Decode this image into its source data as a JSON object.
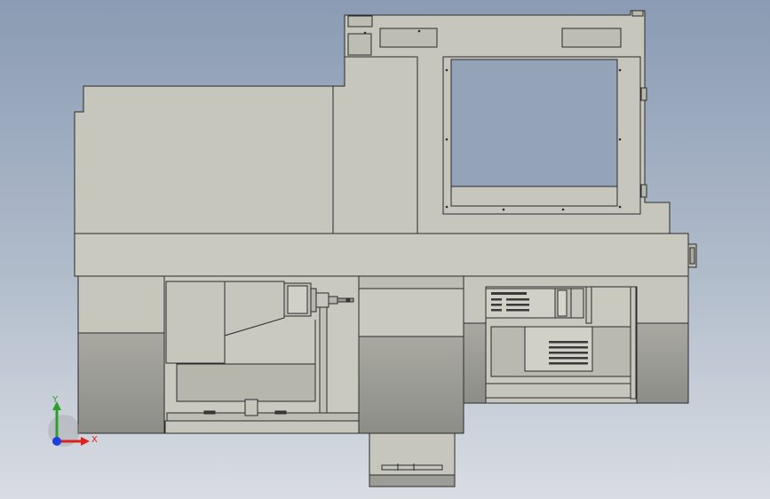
{
  "scene": {
    "view": "front-orthographic",
    "subject": "cnc-machine-assembly",
    "colors": {
      "background_top": "#8a9bb3",
      "background_bottom": "#d9dde3",
      "body": "#c6c6bc",
      "body_shadow": "#aeaea4",
      "base_dark": "#9c9c96",
      "edge": "#2b2b2b",
      "panel_dark": "#3a3a3a"
    }
  },
  "triad": {
    "x_label": "X",
    "y_label": "Y",
    "x_color": "#e0201b",
    "y_color": "#2aa02a",
    "z_color": "#1f3fe0"
  }
}
